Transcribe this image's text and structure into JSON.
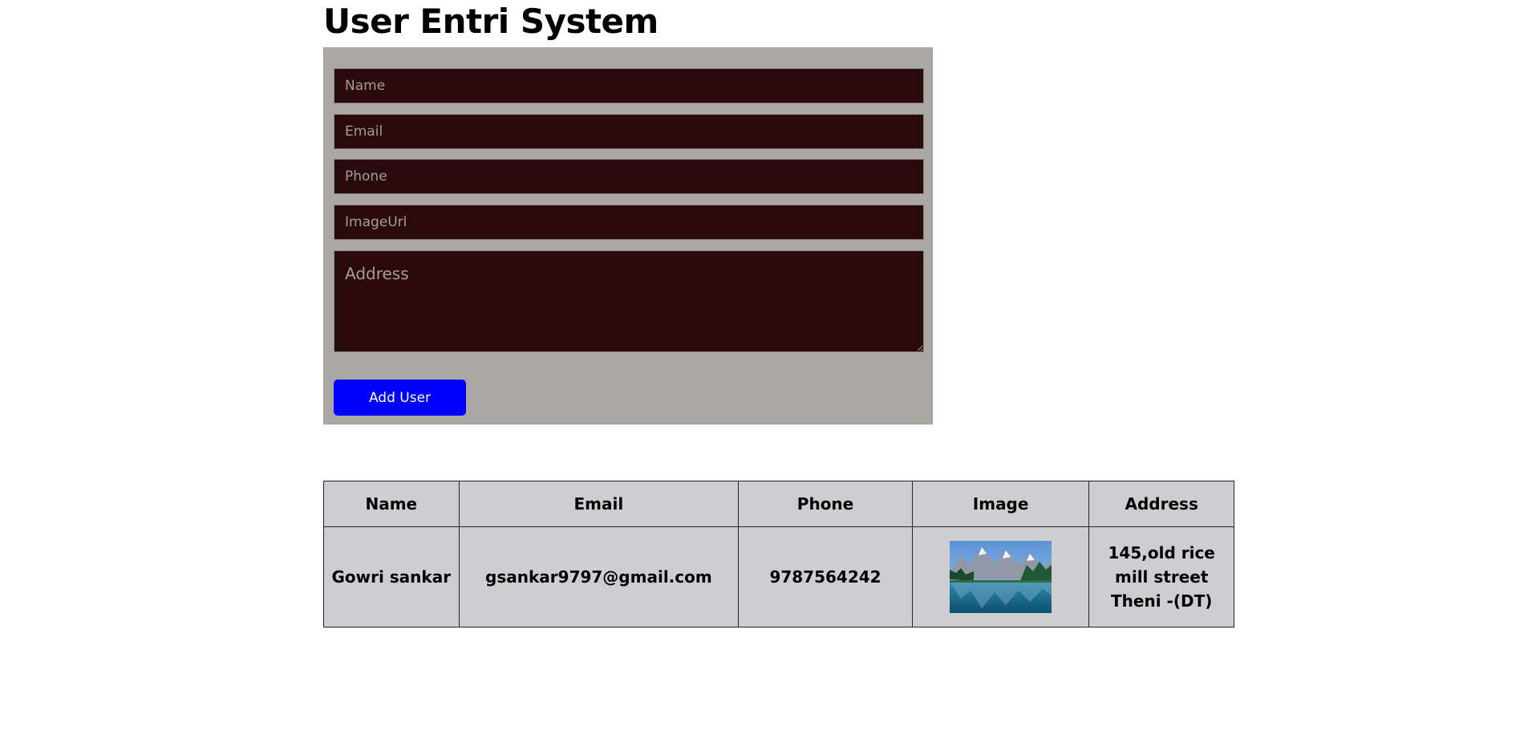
{
  "page": {
    "title": "User Entri System"
  },
  "form": {
    "name_placeholder": "Name",
    "email_placeholder": "Email",
    "phone_placeholder": "Phone",
    "image_url_placeholder": "ImageUrl",
    "address_placeholder": "Address",
    "submit_label": "Add User"
  },
  "table": {
    "headers": [
      "Name",
      "Email",
      "Phone",
      "Image",
      "Address"
    ],
    "rows": [
      {
        "name": "Gowri sankar",
        "email": "gsankar9797@gmail.com",
        "phone": "9787564242",
        "image_icon": "landscape-thumbnail",
        "address_lines": [
          "145,old rice",
          "mill street",
          "Theni -(DT)"
        ]
      }
    ]
  },
  "colors": {
    "panel_bg": "#aba8a3",
    "input_bg": "#2b0a0c",
    "button_bg": "#0000ff",
    "table_bg": "#cdced2"
  }
}
